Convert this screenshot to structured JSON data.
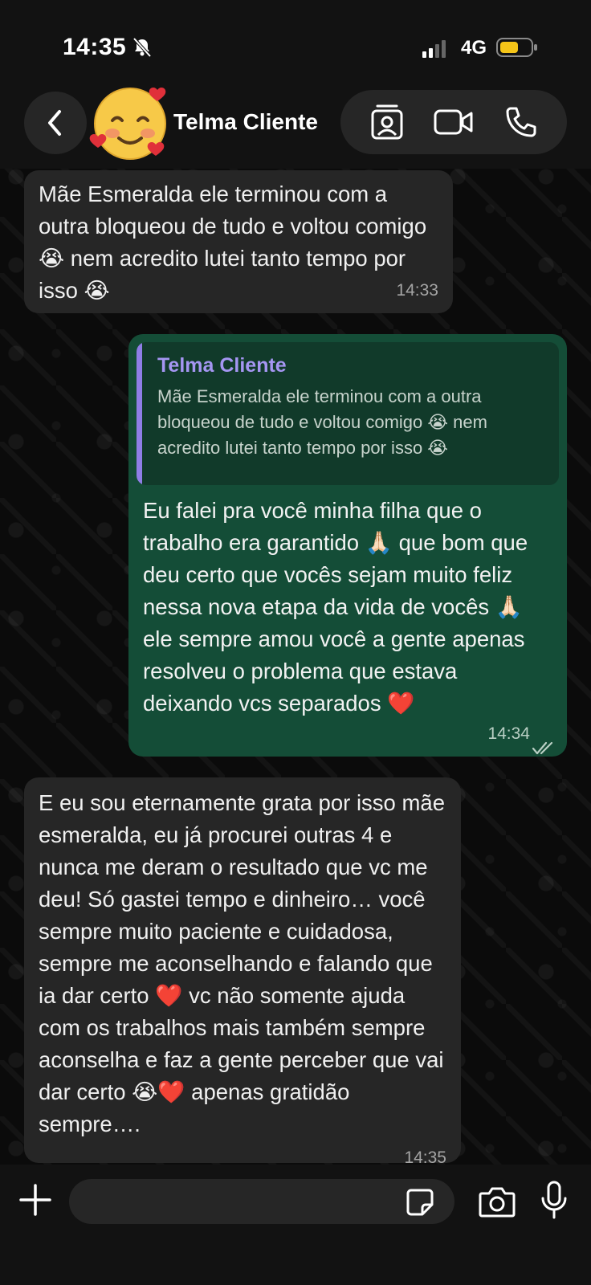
{
  "status_bar": {
    "time": "14:35",
    "network": "4G"
  },
  "header": {
    "contact_name": "Telma Cliente"
  },
  "messages": [
    {
      "direction": "incoming",
      "text": "Mãe Esmeralda ele terminou com a outra bloqueou de tudo e voltou comigo 😭 nem acredito lutei tanto tempo por isso 😭",
      "time": "14:33"
    },
    {
      "direction": "outgoing",
      "quote_author": "Telma Cliente",
      "quote_text": "Mãe Esmeralda ele terminou com a outra bloqueou de tudo e voltou comigo 😭 nem acredito lutei tanto tempo por isso 😭",
      "text": "Eu falei pra você minha filha que o trabalho era garantido 🙏🏻 que bom que deu certo que vocês sejam muito feliz nessa nova etapa da vida de vocês 🙏🏻 ele sempre amou você a gente apenas resolveu o problema que estava deixando vcs separados ❤️",
      "time": "14:34"
    },
    {
      "direction": "incoming",
      "text": "E eu sou eternamente grata por isso mãe esmeralda, eu já procurei outras 4 e nunca me deram o resultado que vc me deu! Só gastei tempo e dinheiro… você sempre muito paciente e cuidadosa, sempre me aconselhando e falando que ia dar certo ❤️ vc não somente ajuda com os trabalhos mais também sempre aconselha e faz a gente perceber que vai dar certo 😭❤️ apenas gratidão sempre….",
      "time": "14:35"
    }
  ],
  "colors": {
    "incoming_bubble": "#262626",
    "outgoing_bubble": "#144d37",
    "quote_accent": "#8f7ee6",
    "battery": "#f5c518"
  },
  "icons": [
    "bell-off-icon",
    "signal-icon",
    "battery-icon",
    "back-chevron-icon",
    "contact-card-icon",
    "video-call-icon",
    "phone-icon",
    "plus-icon",
    "sticker-icon",
    "camera-icon",
    "microphone-icon",
    "double-check-icon"
  ]
}
